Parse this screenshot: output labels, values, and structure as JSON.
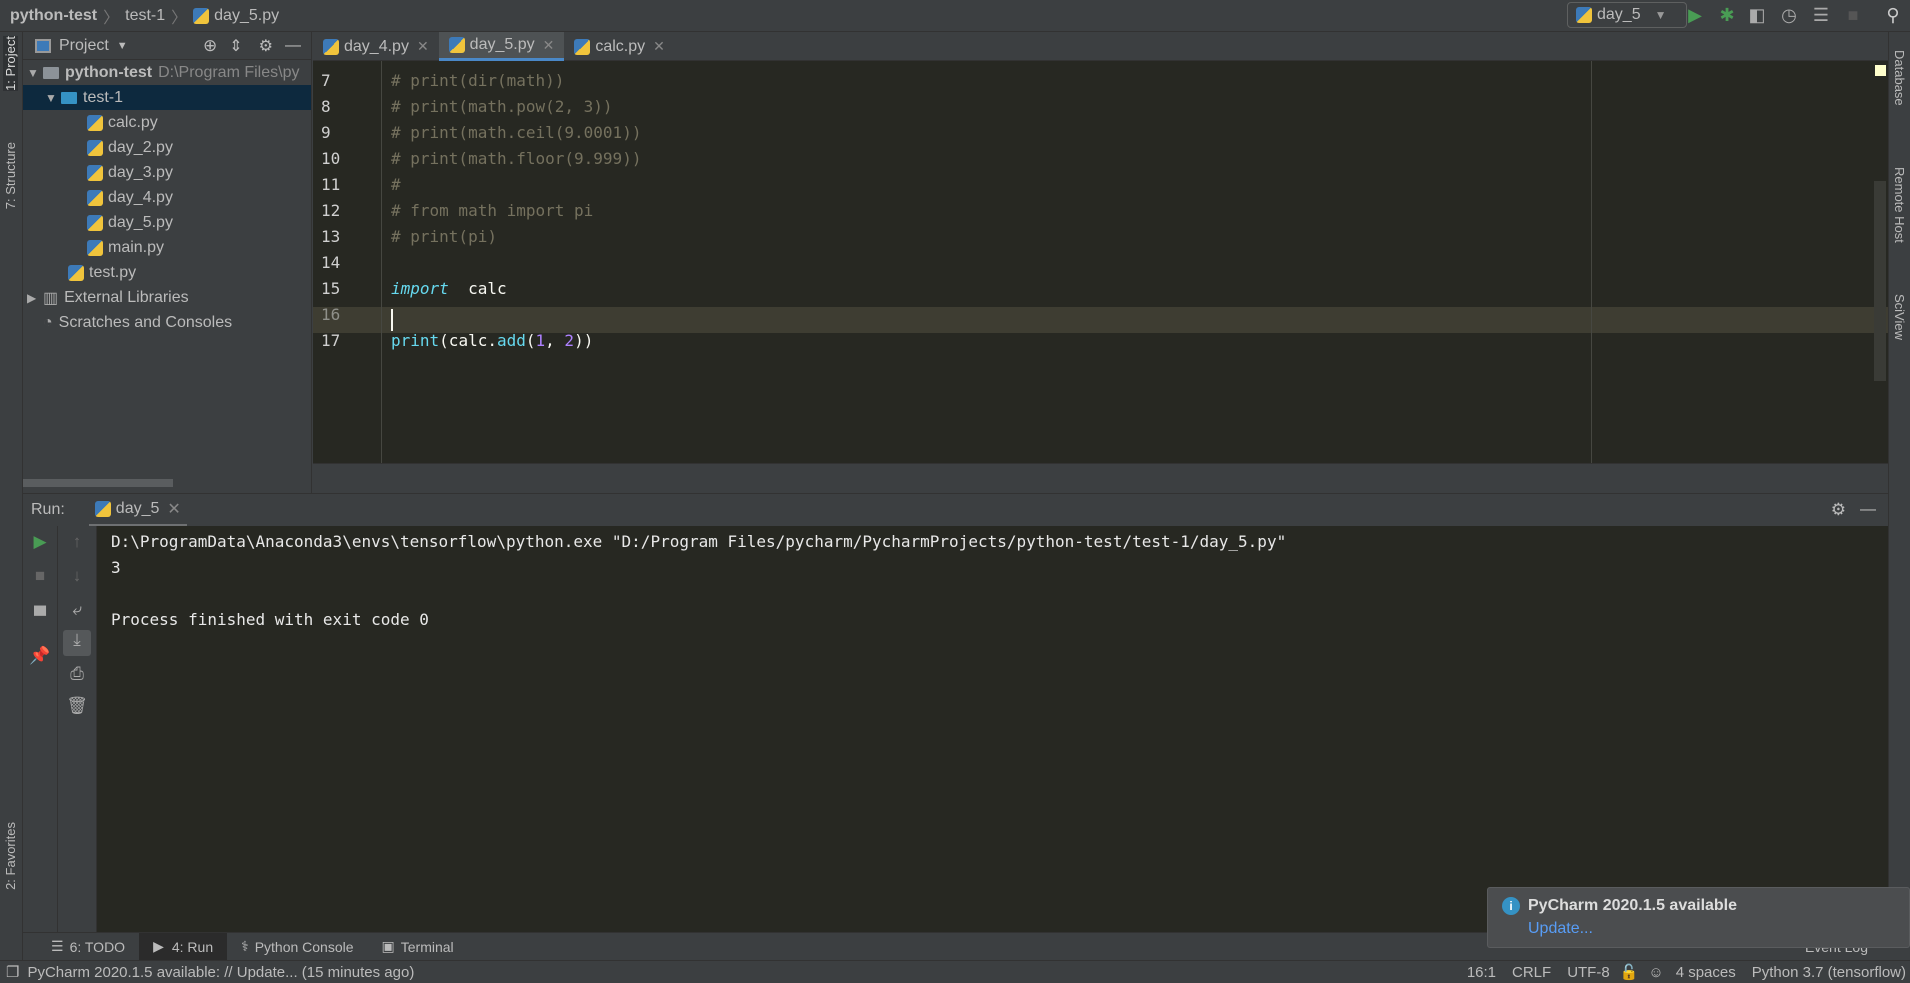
{
  "breadcrumb": [
    "python-test",
    "test-1",
    "day_5.py"
  ],
  "run_config": "day_5",
  "toolbar_icons": [
    "run-icon",
    "debug-icon",
    "coverage-icon",
    "profile-icon",
    "concurrency-icon",
    "stop-icon",
    "search-icon"
  ],
  "left_stripe": {
    "project": "1: Project",
    "structure": "7: Structure",
    "favorites": "2: Favorites"
  },
  "right_stripe": {
    "database": "Database",
    "remote_host": "Remote Host",
    "sciview": "SciView"
  },
  "project_panel": {
    "title": "Project",
    "root": "python-test",
    "root_path": "D:\\Program Files\\py",
    "folder": "test-1",
    "files": [
      "calc.py",
      "day_2.py",
      "day_3.py",
      "day_4.py",
      "day_5.py",
      "main.py"
    ],
    "root_file": "test.py",
    "external": "External Libraries",
    "scratches": "Scratches and Consoles"
  },
  "tabs": [
    {
      "label": "day_4.py"
    },
    {
      "label": "day_5.py",
      "active": true
    },
    {
      "label": "calc.py"
    }
  ],
  "editor": {
    "lines": [
      {
        "n": "7",
        "parts": [
          [
            "cm",
            "# print(dir(math))"
          ]
        ]
      },
      {
        "n": "8",
        "parts": [
          [
            "cm",
            "# print(math.pow(2, 3))"
          ]
        ]
      },
      {
        "n": "9",
        "parts": [
          [
            "cm",
            "# print(math.ceil(9.0001))"
          ]
        ]
      },
      {
        "n": "10",
        "parts": [
          [
            "cm",
            "# print(math.floor(9.999))"
          ]
        ]
      },
      {
        "n": "11",
        "parts": [
          [
            "cm",
            "#"
          ]
        ]
      },
      {
        "n": "12",
        "parts": [
          [
            "cm",
            "# from math import pi"
          ]
        ]
      },
      {
        "n": "13",
        "parts": [
          [
            "cm",
            "# print(pi)"
          ]
        ]
      },
      {
        "n": "14",
        "parts": []
      },
      {
        "n": "15",
        "parts": [
          [
            "kw",
            "import"
          ],
          [
            "",
            "  calc"
          ]
        ]
      },
      {
        "n": "16",
        "parts": []
      },
      {
        "n": "17",
        "parts": [
          [
            "fn",
            "print"
          ],
          [
            "",
            "(calc."
          ],
          [
            "fn",
            "add"
          ],
          [
            "",
            "("
          ],
          [
            "num",
            "1"
          ],
          [
            "",
            ", "
          ],
          [
            "num",
            "2"
          ],
          [
            "",
            "))"
          ]
        ]
      }
    ]
  },
  "run": {
    "label": "Run:",
    "tab": "day_5",
    "output": [
      "D:\\ProgramData\\Anaconda3\\envs\\tensorflow\\python.exe \"D:/Program Files/pycharm/PycharmProjects/python-test/test-1/day_5.py\"",
      "3",
      "",
      "Process finished with exit code 0"
    ]
  },
  "bottom_tabs": [
    "6: TODO",
    "4: Run",
    "Python Console",
    "Terminal"
  ],
  "event_log": "Event Log",
  "notification": {
    "title": "PyCharm 2020.1.5 available",
    "link": "Update..."
  },
  "status": {
    "message": "PyCharm 2020.1.5 available: // Update... (15 minutes ago)",
    "position": "16:1",
    "line_sep": "CRLF",
    "encoding": "UTF-8",
    "indent": "4 spaces",
    "interpreter": "Python 3.7 (tensorflow)"
  }
}
